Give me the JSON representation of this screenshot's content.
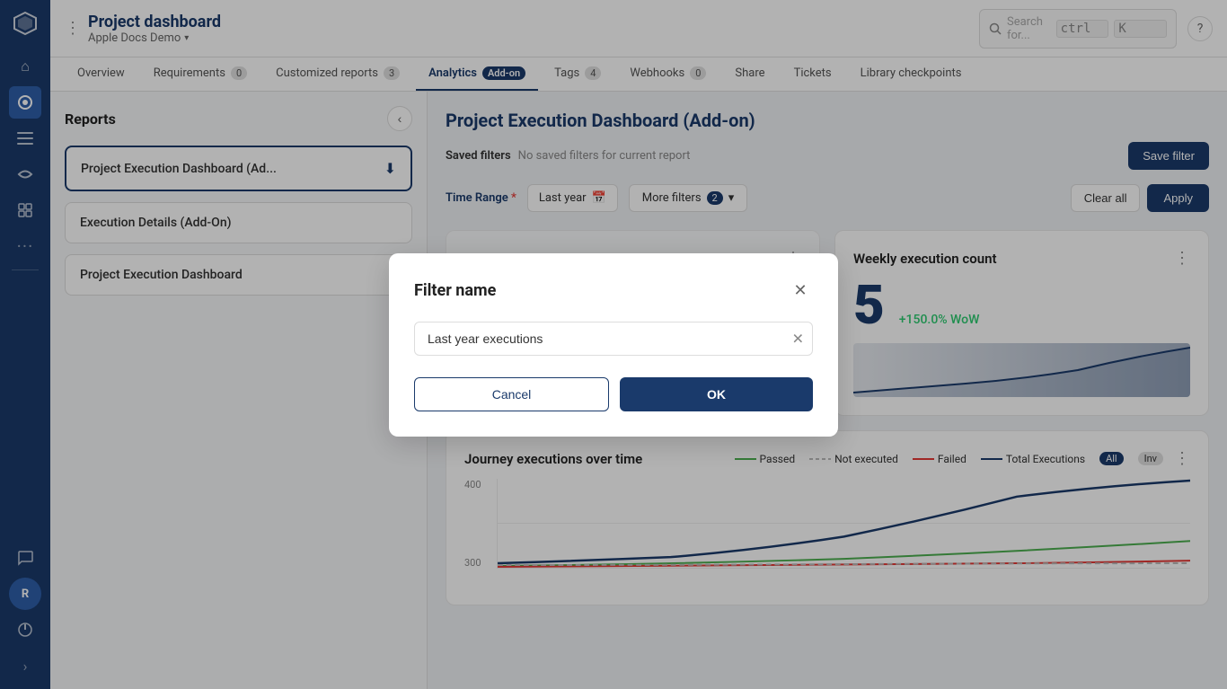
{
  "app": {
    "title": "Project dashboard",
    "subtitle": "Apple Docs Demo",
    "search_placeholder": "Search for...",
    "search_shortcut_key": "ctrl",
    "search_shortcut_char": "K"
  },
  "tabs": [
    {
      "id": "overview",
      "label": "Overview",
      "badge": null,
      "addon": false
    },
    {
      "id": "requirements",
      "label": "Requirements",
      "badge": "0",
      "addon": false
    },
    {
      "id": "customized-reports",
      "label": "Customized reports",
      "badge": "3",
      "addon": false
    },
    {
      "id": "analytics",
      "label": "Analytics",
      "badge": "Add-on",
      "addon": true,
      "active": true
    },
    {
      "id": "tags",
      "label": "Tags",
      "badge": "4",
      "addon": false
    },
    {
      "id": "webhooks",
      "label": "Webhooks",
      "badge": "0",
      "addon": false
    },
    {
      "id": "share",
      "label": "Share",
      "badge": null,
      "addon": false
    },
    {
      "id": "tickets",
      "label": "Tickets",
      "badge": null,
      "addon": false
    },
    {
      "id": "library-checkpoints",
      "label": "Library checkpoints",
      "badge": null,
      "addon": false
    }
  ],
  "reports_sidebar": {
    "title": "Reports",
    "items": [
      {
        "id": "report-1",
        "label": "Project Execution Dashboard (Ad...",
        "active": true,
        "has_download": true
      },
      {
        "id": "report-2",
        "label": "Execution Details (Add-On)",
        "active": false,
        "has_download": false
      },
      {
        "id": "report-3",
        "label": "Project Execution Dashboard",
        "active": false,
        "has_download": false
      }
    ]
  },
  "dashboard": {
    "title": "Project Execution Dashboard (Add-on)",
    "saved_filters_label": "Saved filters",
    "saved_filters_note": "No saved filters for current report",
    "save_filter_btn": "Save filter",
    "time_range_label": "Time Range",
    "time_range_value": "Last year",
    "more_filters_label": "More filters",
    "more_filters_count": "2",
    "clear_all_label": "Clear all",
    "apply_label": "Apply",
    "cards": [
      {
        "id": "card-1",
        "title": "...",
        "metric": "",
        "change": ""
      },
      {
        "id": "weekly-execution-count",
        "title": "Weekly execution count",
        "metric": "5",
        "change": "+150.0% WoW"
      }
    ],
    "journey_chart": {
      "title": "Journey executions over time",
      "legend": [
        {
          "label": "Passed",
          "type": "passed"
        },
        {
          "label": "Not executed",
          "type": "not-executed"
        },
        {
          "label": "Failed",
          "type": "failed"
        },
        {
          "label": "Total Executions",
          "type": "total"
        }
      ],
      "filter_badges": [
        "All",
        "Inv"
      ],
      "y_labels": [
        "400",
        "300"
      ],
      "active_badge": "All"
    }
  },
  "modal": {
    "title": "Filter name",
    "input_value": "Last year executions",
    "cancel_label": "Cancel",
    "ok_label": "OK"
  },
  "sidebar_icons": [
    {
      "name": "home-icon",
      "glyph": "⌂",
      "active": false
    },
    {
      "name": "analytics-icon",
      "glyph": "◎",
      "active": true,
      "highlighted": true
    },
    {
      "name": "list-icon",
      "glyph": "☰",
      "active": false
    },
    {
      "name": "routes-icon",
      "glyph": "↔",
      "active": false
    },
    {
      "name": "package-icon",
      "glyph": "⬡",
      "active": false
    },
    {
      "name": "more-icon",
      "glyph": "···",
      "active": false
    },
    {
      "name": "chat-icon",
      "glyph": "💬",
      "active": false
    },
    {
      "name": "user-icon",
      "glyph": "R",
      "active": false
    },
    {
      "name": "logout-icon",
      "glyph": "⏻",
      "active": false
    },
    {
      "name": "expand-icon",
      "glyph": "›",
      "active": false
    }
  ],
  "colors": {
    "brand": "#1a3a6b",
    "accent": "#2e5faa",
    "success": "#4caf50",
    "danger": "#e53935",
    "neutral": "#bbb"
  }
}
